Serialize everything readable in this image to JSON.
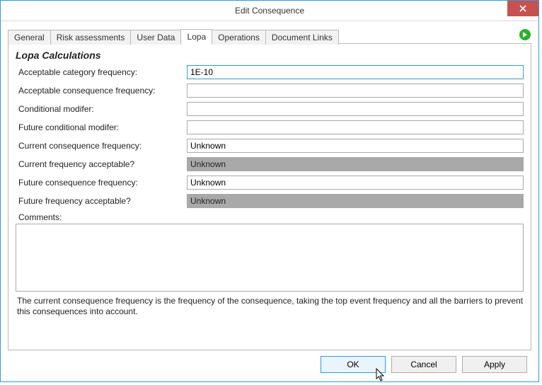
{
  "window": {
    "title": "Edit Consequence"
  },
  "tabs": [
    {
      "label": "General"
    },
    {
      "label": "Risk assessments"
    },
    {
      "label": "User Data"
    },
    {
      "label": "Lopa"
    },
    {
      "label": "Operations"
    },
    {
      "label": "Document Links"
    }
  ],
  "active_tab_index": 3,
  "panel": {
    "title": "Lopa Calculations",
    "fields": {
      "acceptable_category_frequency": {
        "label": "Acceptable category frequency:",
        "value": "1E-10"
      },
      "acceptable_consequence_frequency": {
        "label": "Acceptable consequence frequency:",
        "value": ""
      },
      "conditional_modifier": {
        "label": "Conditional modifer:",
        "value": ""
      },
      "future_conditional_modifier": {
        "label": "Future conditional modifer:",
        "value": ""
      },
      "current_consequence_frequency": {
        "label": "Current consequence frequency:",
        "value": "Unknown"
      },
      "current_frequency_acceptable": {
        "label": "Current frequency acceptable?",
        "value": "Unknown"
      },
      "future_consequence_frequency": {
        "label": "Future consequence frequency:",
        "value": "Unknown"
      },
      "future_frequency_acceptable": {
        "label": "Future frequency acceptable?",
        "value": "Unknown"
      }
    },
    "comments_label": "Comments:",
    "comments_value": "",
    "help_text": "The current consequence frequency is the frequency of the consequence, taking the top event frequency and all the barriers to prevent this consequences into account."
  },
  "buttons": {
    "ok": "OK",
    "cancel": "Cancel",
    "apply": "Apply"
  }
}
